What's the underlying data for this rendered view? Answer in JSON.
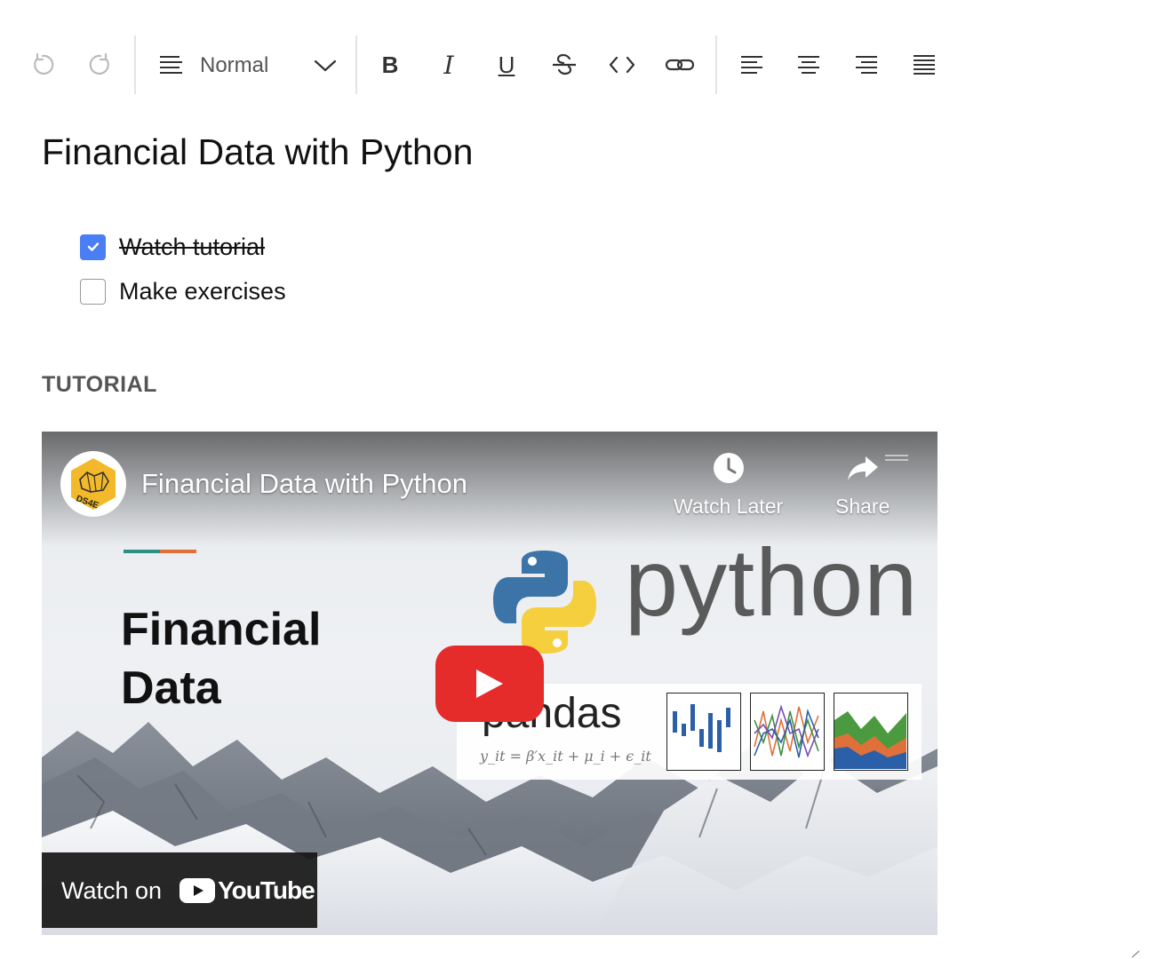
{
  "toolbar": {
    "undo_icon": "undo-icon",
    "redo_icon": "redo-icon",
    "block_type": {
      "icon": "paragraph-lines-icon",
      "value": "Normal"
    },
    "format_icons": [
      "bold-icon",
      "italic-icon",
      "underline-icon",
      "strikethrough-icon",
      "code-icon",
      "link-icon"
    ],
    "bold_glyph": "B",
    "italic_glyph": "I",
    "underline_glyph": "U",
    "align_icons": [
      "align-left-icon",
      "align-center-icon",
      "align-right-icon",
      "align-justify-icon"
    ]
  },
  "document": {
    "title": "Financial Data with Python",
    "todos": [
      {
        "text": "Watch tutorial",
        "checked": true
      },
      {
        "text": "Make exercises",
        "checked": false
      }
    ],
    "section_heading": "TUTORIAL"
  },
  "video": {
    "title": "Financial Data with Python",
    "channel_avatar_icon": "channel-logo-icon",
    "channel_logo_text": "DS4E",
    "actions": [
      {
        "label": "Watch Later",
        "icon": "clock-icon"
      },
      {
        "label": "Share",
        "icon": "share-arrow-icon"
      }
    ],
    "thumbnail": {
      "heading_line1": "Financial",
      "heading_line2": "Data",
      "python_word": "python",
      "pandas_word": "pandas",
      "formula": "y_it = β′x_it + μ_i + ϵ_it"
    },
    "play_icon": "play-icon",
    "watch_on_label": "Watch on",
    "youtube_label": "YouTube"
  },
  "colors": {
    "checkbox_checked": "#4a7ef5",
    "play_button": "#e62b2b",
    "toolbar_icon": "#333333",
    "toolbar_icon_disabled": "#bbbbbb",
    "section_heading": "#555555"
  }
}
